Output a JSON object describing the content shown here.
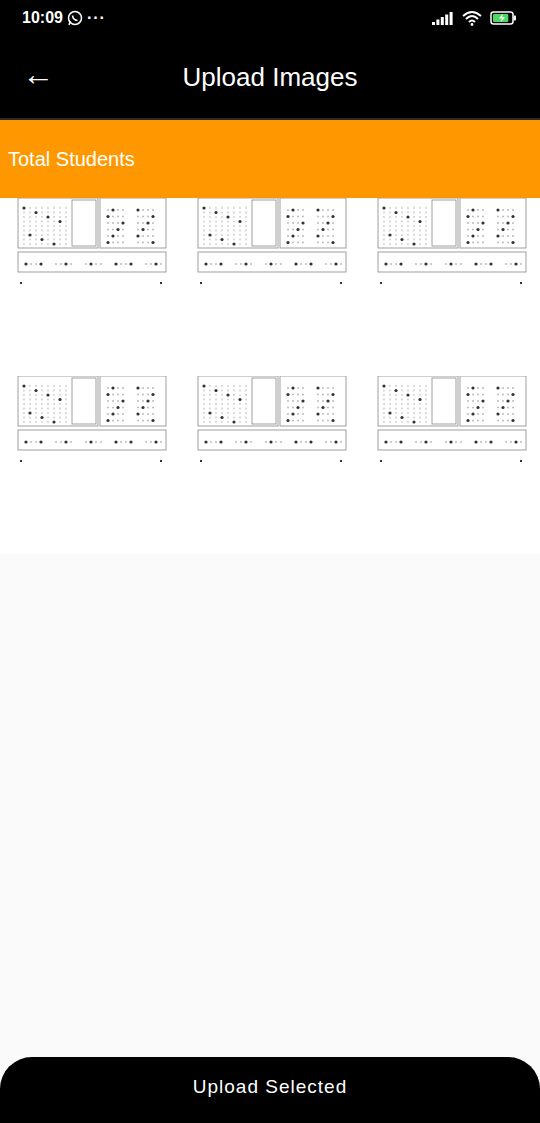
{
  "status_bar": {
    "time": "10:09",
    "dots": "···",
    "battery": {
      "level": 0.85,
      "charging": true
    }
  },
  "app_bar": {
    "back": "←",
    "title": "Upload Images"
  },
  "header": {
    "label": "Total Students"
  },
  "images": [
    {},
    {},
    {},
    {},
    {},
    {}
  ],
  "button": {
    "label": "Upload Selected"
  }
}
